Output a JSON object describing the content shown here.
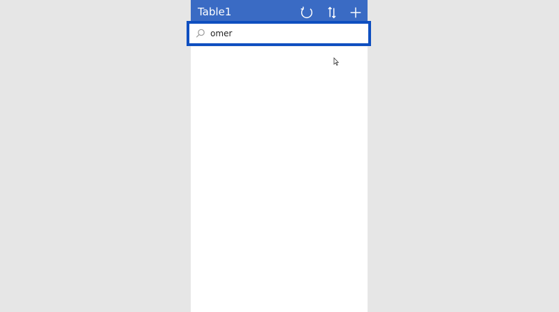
{
  "app": {
    "header": {
      "title": "Table1",
      "icons": [
        "refresh-icon",
        "sort-icon",
        "add-icon"
      ],
      "color": "#3a6bc4"
    },
    "search": {
      "value": "omer",
      "icon": "search-icon",
      "focus_border_color": "#0f4fc0"
    },
    "list": {
      "items": []
    }
  },
  "colors": {
    "background": "#e6e6e6",
    "screen": "#ffffff"
  }
}
